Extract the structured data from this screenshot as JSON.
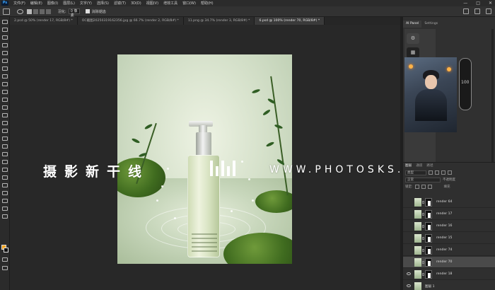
{
  "app": {
    "logo": "Ps"
  },
  "menu": [
    "文件(F)",
    "编辑(E)",
    "图像(I)",
    "图层(L)",
    "文字(Y)",
    "选择(S)",
    "滤镜(T)",
    "3D(D)",
    "视图(V)",
    "增效工具",
    "窗口(W)",
    "帮助(H)"
  ],
  "window_controls": {
    "minimize": "—",
    "maximize": "□",
    "close": "✕"
  },
  "options": {
    "feather_label": "羽化:",
    "feather_value": "0 像素",
    "antialias_label": "消除锯齿"
  },
  "doc_tabs": [
    {
      "label": "2.psd @ 50% (render 17, RGB/8#) *",
      "active": false
    },
    {
      "label": "OC截图20250319162356.jpg @ 66.7% (render 2, RGB/8#) *",
      "active": false
    },
    {
      "label": "11.png @ 34.7% (render 3, RGB/8#) *",
      "active": false
    },
    {
      "label": "6.psd @ 100% (render 70, RGB/8#) *",
      "active": true
    }
  ],
  "watermark": {
    "cn": "摄影新干线",
    "en": "WWW.PHOTOSKS.VIP"
  },
  "right_panel": {
    "tabs": [
      "AI Panel",
      "Settings"
    ],
    "slider_value": "100"
  },
  "layers_panel": {
    "tabs": [
      "图层",
      "通道",
      "路径"
    ],
    "kind_label": "类型",
    "blend_mode": "正常",
    "opacity_label": "不透明度",
    "lock_label": "锁定:",
    "fill_label": "填充",
    "layers": [
      {
        "name": "render 64",
        "selected": false,
        "visible": false
      },
      {
        "name": "render 17",
        "selected": false,
        "visible": false
      },
      {
        "name": "render 16",
        "selected": false,
        "visible": false
      },
      {
        "name": "render 15",
        "selected": false,
        "visible": false
      },
      {
        "name": "render 74",
        "selected": false,
        "visible": false
      },
      {
        "name": "render 70",
        "selected": true,
        "visible": false
      },
      {
        "name": "render 18",
        "selected": false,
        "visible": true
      },
      {
        "name": "图层 1",
        "selected": false,
        "visible": true
      }
    ]
  },
  "colors": {
    "foreground": "#f2a21a",
    "background": "#111111",
    "canvas_bg": "#282828"
  }
}
